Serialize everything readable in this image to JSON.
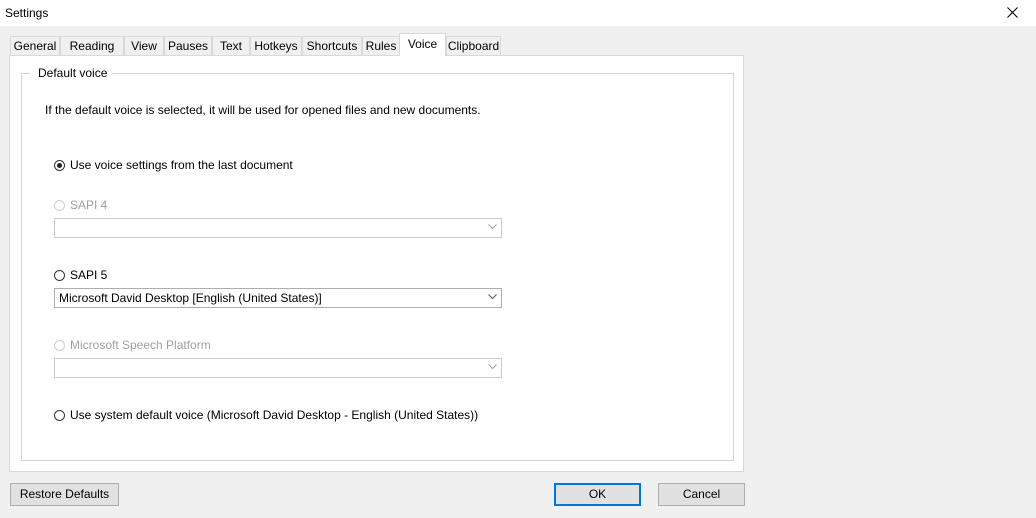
{
  "window": {
    "title": "Settings"
  },
  "tabs": [
    {
      "label": "General"
    },
    {
      "label": "Reading"
    },
    {
      "label": "View"
    },
    {
      "label": "Pauses"
    },
    {
      "label": "Text"
    },
    {
      "label": "Hotkeys"
    },
    {
      "label": "Shortcuts"
    },
    {
      "label": "Rules"
    },
    {
      "label": "Voice",
      "active": true
    },
    {
      "label": "Clipboard"
    }
  ],
  "voice": {
    "group_title": "Default voice",
    "info": "If the default voice is selected, it will be used for opened files and new documents.",
    "options": {
      "last_document": {
        "label": "Use voice settings from the last document",
        "checked": true
      },
      "sapi4": {
        "label": "SAPI 4",
        "enabled": false,
        "selected_voice": ""
      },
      "sapi5": {
        "label": "SAPI 5",
        "enabled": true,
        "selected_voice": "Microsoft David Desktop [English (United States)]"
      },
      "speech_platform": {
        "label": "Microsoft Speech Platform",
        "enabled": false,
        "selected_voice": ""
      },
      "system_default": {
        "label": "Use system default voice (Microsoft David Desktop - English (United States))"
      }
    }
  },
  "buttons": {
    "restore": "Restore Defaults",
    "ok": "OK",
    "cancel": "Cancel"
  },
  "colors": {
    "accent": "#0078d7"
  }
}
